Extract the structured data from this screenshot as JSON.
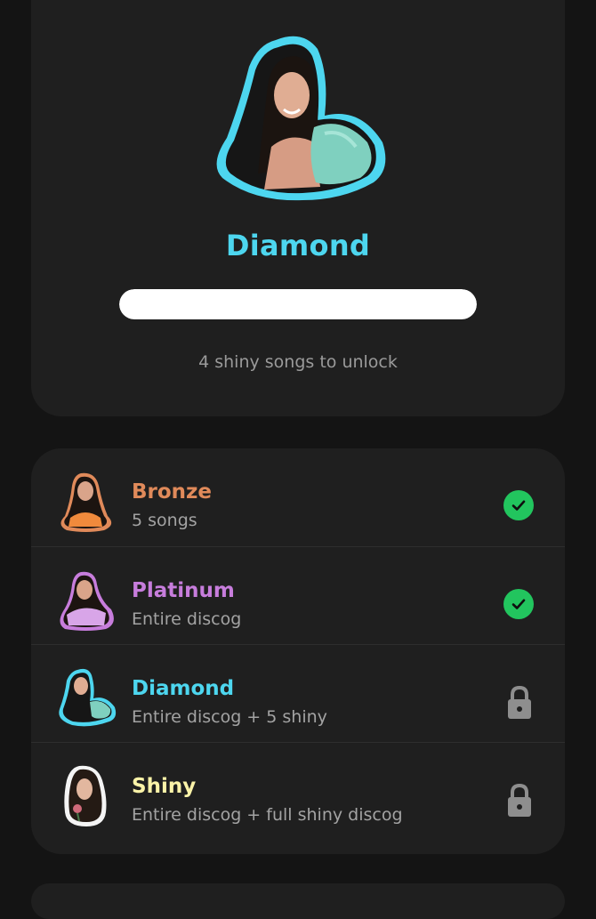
{
  "current_tier": {
    "name": "Diamond",
    "progress": 1.0,
    "unlock_note": "4 shiny songs to unlock",
    "color": "#4dd6ef"
  },
  "tiers": [
    {
      "name": "Bronze",
      "desc": "5 songs",
      "color": "#e08a5a",
      "status": "unlocked",
      "status_icon": "check-icon"
    },
    {
      "name": "Platinum",
      "desc": "Entire discog",
      "color": "#c77ddc",
      "status": "unlocked",
      "status_icon": "check-icon"
    },
    {
      "name": "Diamond",
      "desc": "Entire discog + 5 shiny",
      "color": "#4dd6ef",
      "status": "locked",
      "status_icon": "lock-icon"
    },
    {
      "name": "Shiny",
      "desc": "Entire discog + full shiny discog",
      "color": "#fbf3a8",
      "status": "locked",
      "status_icon": "lock-icon"
    }
  ]
}
